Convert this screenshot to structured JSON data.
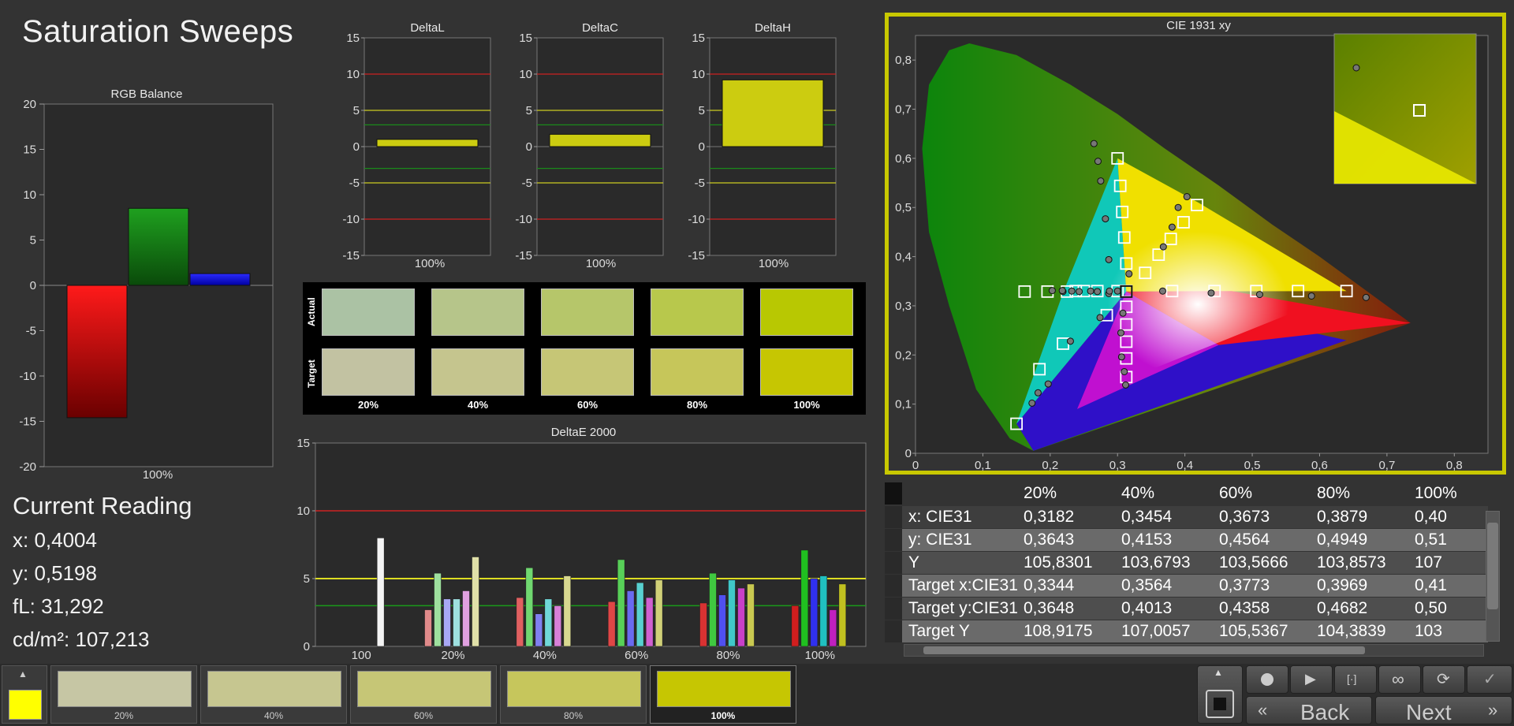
{
  "page_title": "Saturation Sweeps",
  "rgb_balance": {
    "title": "RGB Balance",
    "ticks": [
      "20",
      "15",
      "10",
      "5",
      "0",
      "-5",
      "-10",
      "-15",
      "-20"
    ],
    "xlabel": "100%",
    "values": {
      "red": -14.6,
      "green": 8.5,
      "blue": 1.3
    }
  },
  "delta_l": {
    "title": "DeltaL",
    "xlabel": "100%",
    "value": 1.0
  },
  "delta_c": {
    "title": "DeltaC",
    "xlabel": "100%",
    "value": 1.7
  },
  "delta_h": {
    "title": "DeltaH",
    "xlabel": "100%",
    "value": 9.2
  },
  "delta_ticks": [
    "15",
    "10",
    "5",
    "0",
    "-5",
    "-10",
    "-15"
  ],
  "swatches": {
    "actual_label": "Actual",
    "target_label": "Target",
    "labels": [
      "20%",
      "40%",
      "60%",
      "80%",
      "100%"
    ],
    "actual_colors": [
      "#abc2a4",
      "#b6c58a",
      "#b6c66a",
      "#b8c84c",
      "#b8c802"
    ],
    "target_colors": [
      "#c2c2a2",
      "#c5c58e",
      "#c6c676",
      "#c6c65a",
      "#c6c602"
    ]
  },
  "delta_e": {
    "title": "DeltaE 2000",
    "ticks": [
      "15",
      "10",
      "5",
      "0"
    ],
    "categories": [
      "100",
      "20%",
      "40%",
      "60%",
      "80%",
      "100%"
    ]
  },
  "cie": {
    "title": "CIE 1931 xy",
    "x_ticks": [
      "0",
      "0,1",
      "0,2",
      "0,3",
      "0,4",
      "0,5",
      "0,6",
      "0,7",
      "0,8"
    ],
    "y_ticks": [
      "0,8",
      "0,7",
      "0,6",
      "0,5",
      "0,4",
      "0,3",
      "0,2",
      "0,1",
      "0"
    ]
  },
  "current_reading": {
    "heading": "Current Reading",
    "x": "x: 0,4004",
    "y": "y: 0,5198",
    "fl": "fL: 31,292",
    "cdm2": "cd/m²: 107,213"
  },
  "table": {
    "headers": [
      "20%",
      "40%",
      "60%",
      "80%",
      "100%"
    ],
    "rows": [
      {
        "label": "x: CIE31",
        "values": [
          "0,3182",
          "0,3454",
          "0,3673",
          "0,3879",
          "0,40"
        ]
      },
      {
        "label": "y: CIE31",
        "values": [
          "0,3643",
          "0,4153",
          "0,4564",
          "0,4949",
          "0,51"
        ]
      },
      {
        "label": "Y",
        "values": [
          "105,8301",
          "103,6793",
          "103,5666",
          "103,8573",
          "107"
        ]
      },
      {
        "label": "Target x:CIE31",
        "values": [
          "0,3344",
          "0,3564",
          "0,3773",
          "0,3969",
          "0,41"
        ]
      },
      {
        "label": "Target y:CIE31",
        "values": [
          "0,3648",
          "0,4013",
          "0,4358",
          "0,4682",
          "0,50"
        ]
      },
      {
        "label": "Target Y",
        "values": [
          "108,9175",
          "107,0057",
          "105,5367",
          "104,3839",
          "103"
        ]
      }
    ]
  },
  "bottom": {
    "current_color": "#ffff00",
    "thumbs": [
      {
        "label": "20%",
        "color": "#c6c6a4"
      },
      {
        "label": "40%",
        "color": "#c6c690"
      },
      {
        "label": "60%",
        "color": "#c6c676"
      },
      {
        "label": "80%",
        "color": "#c6c65c"
      },
      {
        "label": "100%",
        "color": "#c6c602"
      }
    ],
    "back_label": "Back",
    "next_label": "Next"
  },
  "chart_data": [
    {
      "type": "bar",
      "title": "RGB Balance",
      "categories": [
        "100%"
      ],
      "series": [
        {
          "name": "Red",
          "values": [
            -14.6
          ]
        },
        {
          "name": "Green",
          "values": [
            8.5
          ]
        },
        {
          "name": "Blue",
          "values": [
            1.3
          ]
        }
      ],
      "ylim": [
        -20,
        20
      ]
    },
    {
      "type": "bar",
      "title": "DeltaL",
      "categories": [
        "100%"
      ],
      "values": [
        1.0
      ],
      "ylim": [
        -15,
        15
      ]
    },
    {
      "type": "bar",
      "title": "DeltaC",
      "categories": [
        "100%"
      ],
      "values": [
        1.7
      ],
      "ylim": [
        -15,
        15
      ]
    },
    {
      "type": "bar",
      "title": "DeltaH",
      "categories": [
        "100%"
      ],
      "values": [
        9.2
      ],
      "ylim": [
        -15,
        15
      ]
    },
    {
      "type": "bar",
      "title": "DeltaE 2000",
      "categories": [
        "100",
        "20%",
        "40%",
        "60%",
        "80%",
        "100%"
      ],
      "groups": [
        {
          "category": "100",
          "bars": [
            {
              "color": "#f4f4f4",
              "value": 8.0
            }
          ]
        },
        {
          "category": "20%",
          "bars": [
            {
              "color": "#e08a8a",
              "value": 2.7
            },
            {
              "color": "#9ee09e",
              "value": 5.4
            },
            {
              "color": "#a8a8f4",
              "value": 3.5
            },
            {
              "color": "#9ee0e0",
              "value": 3.5
            },
            {
              "color": "#e0a0e0",
              "value": 4.1
            },
            {
              "color": "#e0e0a8",
              "value": 6.6
            }
          ]
        },
        {
          "category": "40%",
          "bars": [
            {
              "color": "#e06060",
              "value": 3.6
            },
            {
              "color": "#70d870",
              "value": 5.8
            },
            {
              "color": "#8080f0",
              "value": 2.4
            },
            {
              "color": "#70d8d8",
              "value": 3.5
            },
            {
              "color": "#d880d8",
              "value": 3.0
            },
            {
              "color": "#d8d890",
              "value": 5.2
            }
          ]
        },
        {
          "category": "60%",
          "bars": [
            {
              "color": "#e04646",
              "value": 3.3
            },
            {
              "color": "#58d058",
              "value": 6.4
            },
            {
              "color": "#6a6af0",
              "value": 4.1
            },
            {
              "color": "#58d0d0",
              "value": 4.7
            },
            {
              "color": "#d060d0",
              "value": 3.6
            },
            {
              "color": "#d0d078",
              "value": 4.9
            }
          ]
        },
        {
          "category": "80%",
          "bars": [
            {
              "color": "#d83232",
              "value": 3.2
            },
            {
              "color": "#40c840",
              "value": 5.4
            },
            {
              "color": "#5050f0",
              "value": 3.8
            },
            {
              "color": "#40c8c8",
              "value": 4.9
            },
            {
              "color": "#c840c8",
              "value": 4.3
            },
            {
              "color": "#c8c850",
              "value": 4.6
            }
          ]
        },
        {
          "category": "100%",
          "bars": [
            {
              "color": "#d01e1e",
              "value": 3.0
            },
            {
              "color": "#20c020",
              "value": 7.1
            },
            {
              "color": "#3030f0",
              "value": 5.0
            },
            {
              "color": "#20c0c0",
              "value": 5.2
            },
            {
              "color": "#c020c0",
              "value": 2.7
            },
            {
              "color": "#c0c020",
              "value": 4.6
            }
          ]
        }
      ],
      "ylim": [
        0,
        15
      ]
    },
    {
      "type": "scatter",
      "title": "CIE 1931 xy",
      "xlim": [
        0,
        0.85
      ],
      "ylim": [
        0,
        0.85
      ],
      "series": [
        {
          "marker": "square",
          "points": [
            [
              0.64,
              0.33
            ],
            [
              0.568,
              0.33
            ],
            [
              0.506,
              0.33
            ],
            [
              0.444,
              0.33
            ],
            [
              0.381,
              0.33
            ],
            [
              0.3,
              0.6
            ],
            [
              0.304,
              0.544
            ],
            [
              0.307,
              0.491
            ],
            [
              0.31,
              0.439
            ],
            [
              0.313,
              0.386
            ],
            [
              0.15,
              0.06
            ],
            [
              0.184,
              0.171
            ],
            [
              0.219,
              0.223
            ],
            [
              0.25,
              0.33
            ],
            [
              0.284,
              0.281
            ],
            [
              0.418,
              0.505
            ],
            [
              0.398,
              0.47
            ],
            [
              0.379,
              0.436
            ],
            [
              0.361,
              0.404
            ],
            [
              0.341,
              0.367
            ],
            [
              0.225,
              0.329
            ],
            [
              0.196,
              0.329
            ],
            [
              0.162,
              0.329
            ],
            [
              0.313,
              0.329
            ],
            [
              0.313,
              0.155
            ],
            [
              0.313,
              0.193
            ],
            [
              0.313,
              0.227
            ],
            [
              0.313,
              0.262
            ],
            [
              0.313,
              0.298
            ],
            [
              0.313,
              0.33
            ],
            [
              0.3,
              0.33
            ],
            [
              0.27,
              0.33
            ],
            [
              0.238,
              0.33
            ]
          ]
        },
        {
          "marker": "circle",
          "points": [
            [
              0.669,
              0.317
            ],
            [
              0.588,
              0.32
            ],
            [
              0.511,
              0.323
            ],
            [
              0.439,
              0.326
            ],
            [
              0.367,
              0.33
            ],
            [
              0.265,
              0.63
            ],
            [
              0.271,
              0.594
            ],
            [
              0.275,
              0.554
            ],
            [
              0.282,
              0.477
            ],
            [
              0.287,
              0.394
            ],
            [
              0.173,
              0.102
            ],
            [
              0.182,
              0.123
            ],
            [
              0.197,
              0.141
            ],
            [
              0.23,
              0.228
            ],
            [
              0.274,
              0.276
            ],
            [
              0.403,
              0.522
            ],
            [
              0.39,
              0.5
            ],
            [
              0.381,
              0.46
            ],
            [
              0.368,
              0.42
            ],
            [
              0.317,
              0.365
            ],
            [
              0.27,
              0.329
            ],
            [
              0.243,
              0.329
            ],
            [
              0.219,
              0.329
            ],
            [
              0.203,
              0.331
            ],
            [
              0.287,
              0.325
            ],
            [
              0.312,
              0.139
            ],
            [
              0.31,
              0.166
            ],
            [
              0.306,
              0.196
            ],
            [
              0.305,
              0.245
            ],
            [
              0.308,
              0.285
            ],
            [
              0.288,
              0.33
            ],
            [
              0.26,
              0.33
            ],
            [
              0.232,
              0.33
            ],
            [
              0.218,
              0.331
            ],
            [
              0.3,
              0.33
            ]
          ]
        }
      ]
    }
  ]
}
